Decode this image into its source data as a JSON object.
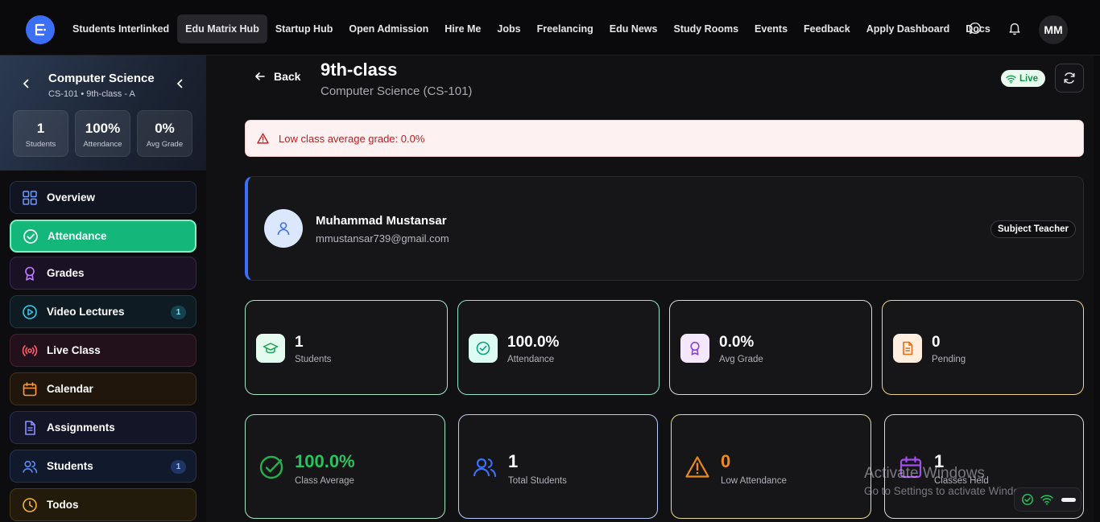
{
  "nav": {
    "logo_letter": "E",
    "links": [
      "Students Interlinked",
      "Edu Matrix Hub",
      "Startup Hub",
      "Open Admission",
      "Hire Me",
      "Jobs",
      "Freelancing",
      "Edu News",
      "Study Rooms",
      "Events",
      "Feedback",
      "Apply Dashboard",
      "Docs"
    ],
    "active_link": "Edu Matrix Hub",
    "avatar_initials": "MM"
  },
  "sidebar": {
    "course_title": "Computer Science",
    "course_sub": "CS-101 • 9th-class - A",
    "stats": [
      {
        "value": "1",
        "label": "Students"
      },
      {
        "value": "100%",
        "label": "Attendance"
      },
      {
        "value": "0%",
        "label": "Avg Grade"
      }
    ],
    "items": [
      {
        "label": "Overview",
        "icon": "grid-icon",
        "color": "#6f9bff"
      },
      {
        "label": "Attendance",
        "icon": "check-circle-icon",
        "color": "#ffffff",
        "active": true
      },
      {
        "label": "Grades",
        "icon": "award-icon",
        "color": "#c07bff"
      },
      {
        "label": "Video Lectures",
        "icon": "play-circle-icon",
        "color": "#38c8e8",
        "badge": "1"
      },
      {
        "label": "Live Class",
        "icon": "broadcast-icon",
        "color": "#ff5c6c"
      },
      {
        "label": "Calendar",
        "icon": "calendar-icon",
        "color": "#ff9a3c"
      },
      {
        "label": "Assignments",
        "icon": "document-icon",
        "color": "#8a8fff"
      },
      {
        "label": "Students",
        "icon": "users-icon",
        "color": "#5b8cff",
        "badge": "1"
      },
      {
        "label": "Todos",
        "icon": "clock-icon",
        "color": "#f5b731"
      }
    ]
  },
  "header": {
    "back_label": "Back",
    "title": "9th-class",
    "subtitle": "Computer Science (CS-101)",
    "live_label": "Live"
  },
  "alert": {
    "text": "Low class average grade: 0.0%"
  },
  "teacher": {
    "name": "Muhammad Mustansar",
    "email": "mmustansar739@gmail.com",
    "role": "Subject Teacher"
  },
  "stats_row1": [
    {
      "value": "1",
      "label": "Students",
      "icon": "graduation-cap-icon",
      "border": "#a7e6c4",
      "bg": "#e4fbef",
      "fg": "#16a34a"
    },
    {
      "value": "100.0%",
      "label": "Attendance",
      "icon": "check-circle-icon",
      "border": "#8fe3cf",
      "bg": "#dcfbf3",
      "fg": "#0f9f80"
    },
    {
      "value": "0.0%",
      "label": "Avg Grade",
      "icon": "award-icon",
      "border": "#d8d8df",
      "bg": "#f3e8ff",
      "fg": "#8b3fe0"
    },
    {
      "value": "0",
      "label": "Pending",
      "icon": "document-icon",
      "border": "#ecd48a",
      "bg": "#ffeedd",
      "fg": "#e0701b"
    }
  ],
  "stats_row2": [
    {
      "value": "100.0%",
      "label": "Class Average",
      "icon": "check-circle-icon",
      "border": "#a7e6c4",
      "fg": "#22b14c",
      "value_color": "#22c55e"
    },
    {
      "value": "1",
      "label": "Total Students",
      "icon": "users-icon",
      "border": "#b9cdfa",
      "fg": "#3b6ff5",
      "value_color": "#ffffff"
    },
    {
      "value": "0",
      "label": "Low Attendance",
      "icon": "warning-icon",
      "border": "#e9d98c",
      "fg": "#ea8a1c",
      "value_color": "#f08a1c"
    },
    {
      "value": "1",
      "label": "Classes Held",
      "icon": "calendar-icon",
      "border": "#d8d8df",
      "fg": "#a24df0",
      "value_color": "#ffffff"
    }
  ],
  "watermark": {
    "line1": "Activate Windows",
    "line2": "Go to Settings to activate Windows."
  }
}
